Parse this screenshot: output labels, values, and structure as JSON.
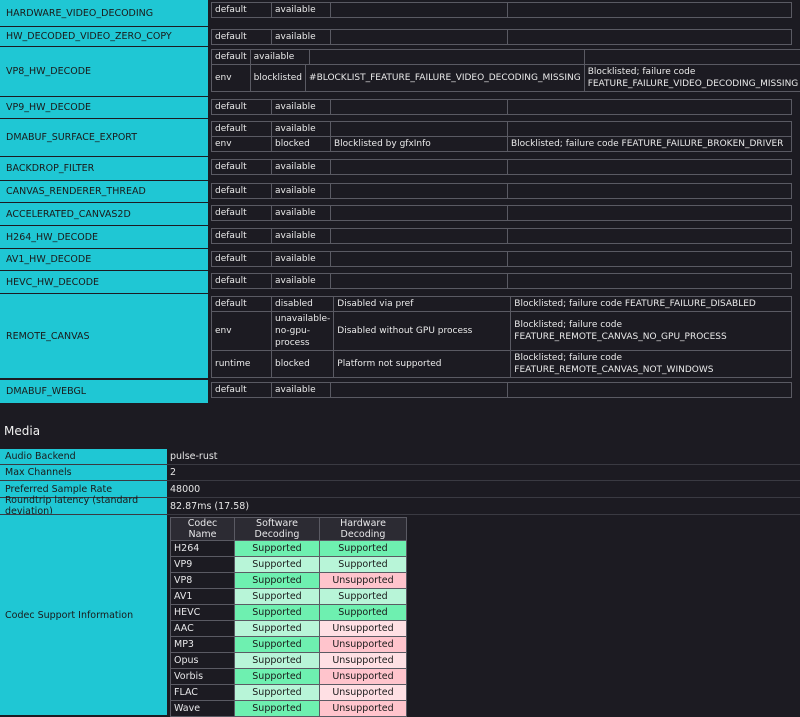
{
  "features": [
    {
      "name": "HARDWARE_VIDEO_DECODING",
      "rows": [
        [
          "default",
          "available",
          "",
          ""
        ]
      ]
    },
    {
      "name": "HW_DECODED_VIDEO_ZERO_COPY",
      "rows": [
        [
          "default",
          "available",
          "",
          ""
        ]
      ]
    },
    {
      "name": "VP8_HW_DECODE",
      "split": true,
      "rows": [
        [
          "default",
          "available",
          "",
          ""
        ],
        [
          "env",
          "blocklisted",
          "#BLOCKLIST_FEATURE_FAILURE_VIDEO_DECODING_MISSING",
          "Blocklisted; failure code FEATURE_FAILURE_VIDEO_DECODING_MISSING"
        ]
      ]
    },
    {
      "name": "VP9_HW_DECODE",
      "rows": [
        [
          "default",
          "available",
          "",
          ""
        ]
      ]
    },
    {
      "name": "DMABUF_SURFACE_EXPORT",
      "rows": [
        [
          "default",
          "available",
          "",
          ""
        ],
        [
          "env",
          "blocked",
          "Blocklisted by gfxInfo",
          "Blocklisted; failure code FEATURE_FAILURE_BROKEN_DRIVER"
        ]
      ]
    },
    {
      "name": "BACKDROP_FILTER",
      "rows": [
        [
          "default",
          "available",
          "",
          ""
        ]
      ]
    },
    {
      "name": "CANVAS_RENDERER_THREAD",
      "rows": [
        [
          "default",
          "available",
          "",
          ""
        ]
      ]
    },
    {
      "name": "ACCELERATED_CANVAS2D",
      "rows": [
        [
          "default",
          "available",
          "",
          ""
        ]
      ]
    },
    {
      "name": "H264_HW_DECODE",
      "rows": [
        [
          "default",
          "available",
          "",
          ""
        ]
      ]
    },
    {
      "name": "AV1_HW_DECODE",
      "rows": [
        [
          "default",
          "available",
          "",
          ""
        ]
      ]
    },
    {
      "name": "HEVC_HW_DECODE",
      "rows": [
        [
          "default",
          "available",
          "",
          ""
        ]
      ]
    },
    {
      "name": "REMOTE_CANVAS",
      "rows": [
        [
          "default",
          "disabled",
          "Disabled via pref",
          "Blocklisted; failure code FEATURE_FAILURE_DISABLED"
        ],
        [
          "env",
          "unavailable-no-gpu-process",
          "Disabled without GPU process",
          "Blocklisted; failure code FEATURE_REMOTE_CANVAS_NO_GPU_PROCESS"
        ],
        [
          "runtime",
          "blocked",
          "Platform not supported",
          "Blocklisted; failure code FEATURE_REMOTE_CANVAS_NOT_WINDOWS"
        ]
      ]
    },
    {
      "name": "DMABUF_WEBGL",
      "rows": [
        [
          "default",
          "available",
          "",
          ""
        ]
      ]
    }
  ],
  "media": {
    "heading": "Media",
    "rows": [
      {
        "label": "Audio Backend",
        "value": "pulse-rust"
      },
      {
        "label": "Max Channels",
        "value": "2"
      },
      {
        "label": "Preferred Sample Rate",
        "value": "48000"
      },
      {
        "label": "Roundtrip latency (standard deviation)",
        "value": "82.87ms (17.58)"
      }
    ],
    "codec_label": "Codec Support Information",
    "codec_headers": [
      "Codec Name",
      "Software Decoding",
      "Hardware Decoding"
    ],
    "codecs": [
      {
        "name": "H264",
        "sw": "Supported",
        "hw": "Supported"
      },
      {
        "name": "VP9",
        "sw": "Supported",
        "hw": "Supported"
      },
      {
        "name": "VP8",
        "sw": "Supported",
        "hw": "Unsupported"
      },
      {
        "name": "AV1",
        "sw": "Supported",
        "hw": "Supported"
      },
      {
        "name": "HEVC",
        "sw": "Supported",
        "hw": "Supported"
      },
      {
        "name": "AAC",
        "sw": "Supported",
        "hw": "Unsupported"
      },
      {
        "name": "MP3",
        "sw": "Supported",
        "hw": "Unsupported"
      },
      {
        "name": "Opus",
        "sw": "Supported",
        "hw": "Unsupported"
      },
      {
        "name": "Vorbis",
        "sw": "Supported",
        "hw": "Unsupported"
      },
      {
        "name": "FLAC",
        "sw": "Supported",
        "hw": "Unsupported"
      },
      {
        "name": "Wave",
        "sw": "Supported",
        "hw": "Unsupported"
      }
    ]
  },
  "colors": {
    "label_bg": "#1fc7d4",
    "supported_strong": "#6ef0b0",
    "supported_light": "#b8f5d8",
    "unsupported_strong": "#ffc4cc",
    "unsupported_light": "#ffe0e4"
  }
}
